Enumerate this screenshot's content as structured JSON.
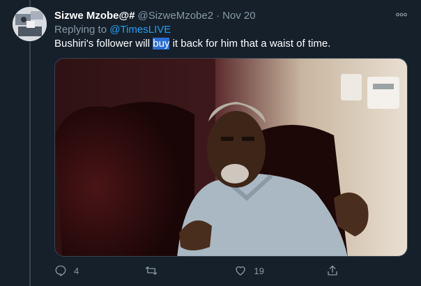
{
  "tweet": {
    "display_name": "Sizwe Mzobe@#",
    "handle": "@SizweMzobe2",
    "separator": "·",
    "date": "Nov 20",
    "replying_prefix": "Replying to ",
    "replying_to": "@TimesLIVE",
    "text_before": "Bushiri's follower will ",
    "text_highlight": "buy",
    "text_after": " it back for him that a waist of time.",
    "more_icon": "more-horizontal-icon",
    "media_icon": "photo-image"
  },
  "actions": {
    "reply": {
      "icon": "reply-icon",
      "count": "4"
    },
    "retweet": {
      "icon": "retweet-icon",
      "count": ""
    },
    "like": {
      "icon": "heart-icon",
      "count": "19"
    },
    "share": {
      "icon": "share-icon",
      "count": ""
    }
  },
  "colors": {
    "background": "#15202b",
    "secondary_text": "#8899a6",
    "link": "#1da1f2",
    "selection": "#2a6ed6"
  }
}
